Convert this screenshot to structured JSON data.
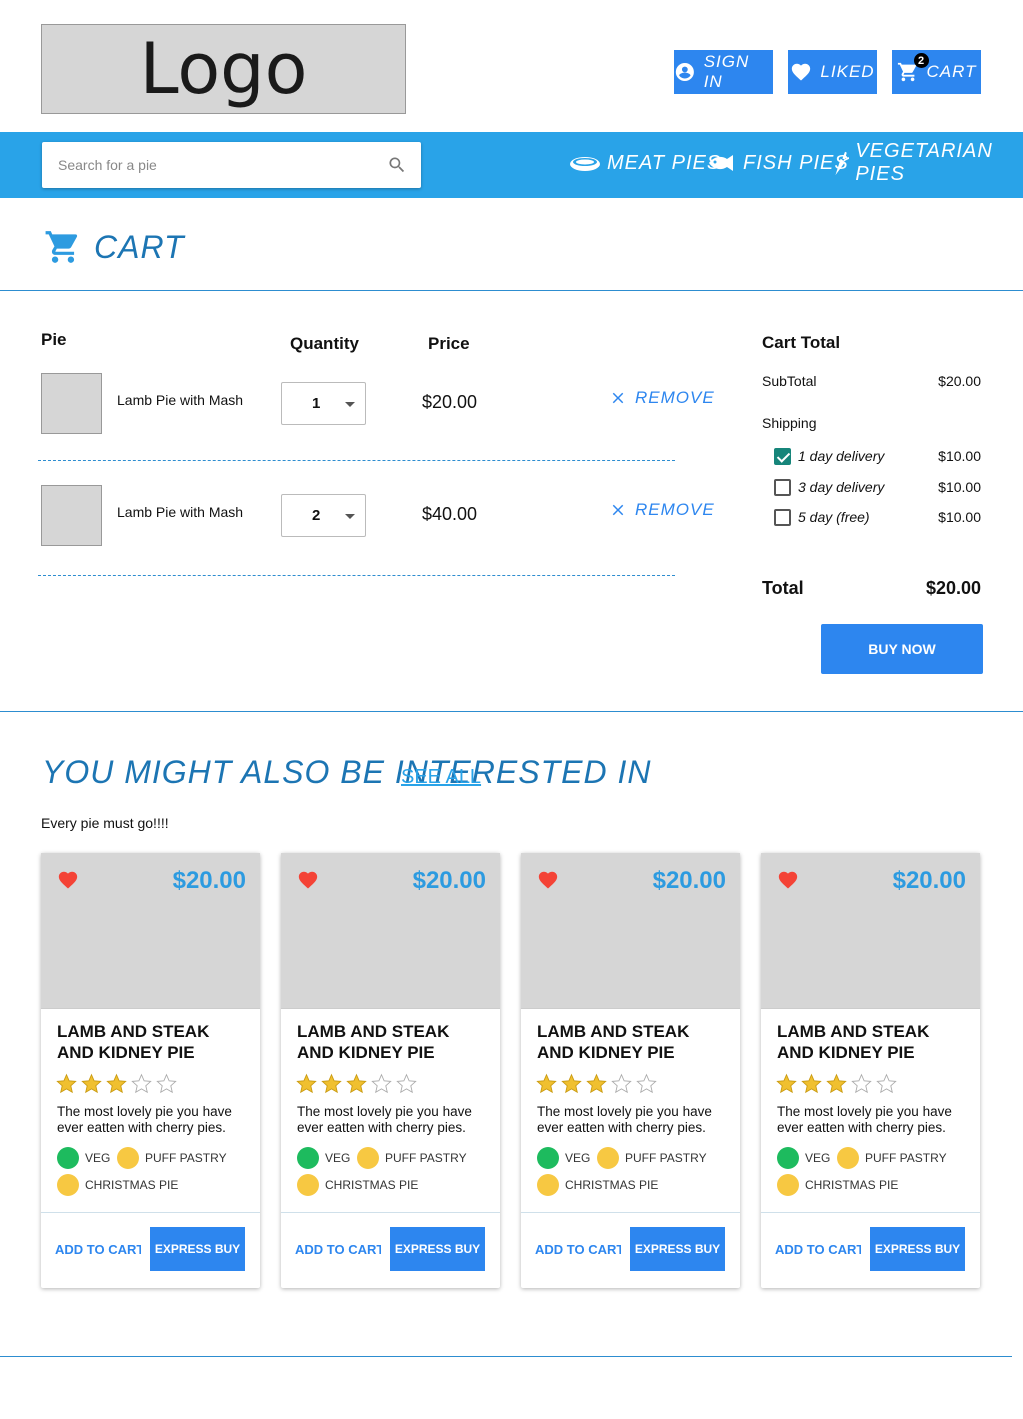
{
  "header": {
    "logo_text": "Logo",
    "sign_in_label": "SIGN IN",
    "liked_label": "LIKED",
    "cart_label": "CART",
    "cart_count": "2"
  },
  "nav": {
    "search_placeholder": "Search for a pie",
    "links": [
      "MEAT PIES",
      "FISH PIES",
      "VEGETARIAN PIES"
    ]
  },
  "cart": {
    "heading": "CART",
    "columns": {
      "pie": "Pie",
      "quantity": "Quantity",
      "price": "Price"
    },
    "remove_label": "REMOVE",
    "items": [
      {
        "name": "Lamb Pie with Mash",
        "quantity": "1",
        "price": "$20.00"
      },
      {
        "name": "Lamb Pie with Mash",
        "quantity": "2",
        "price": "$40.00"
      }
    ]
  },
  "cart_total": {
    "title": "Cart Total",
    "subtotal_label": "SubTotal",
    "subtotal_value": "$20.00",
    "shipping_label": "Shipping",
    "shipping_options": [
      {
        "label": "1 day delivery",
        "price": "$10.00",
        "checked": true
      },
      {
        "label": "3 day delivery",
        "price": "$10.00",
        "checked": false
      },
      {
        "label": "5 day (free)",
        "price": "$10.00",
        "checked": false
      }
    ],
    "total_label": "Total",
    "total_value": "$20.00",
    "buy_now_label": "BUY NOW"
  },
  "recommendations": {
    "title": "YOU MIGHT ALSO BE INTERESTED IN",
    "see_all_label": "SEE ALL",
    "subtitle": "Every pie must go!!!!",
    "products": [
      {
        "price": "$20.00",
        "title": "LAMB AND STEAK AND KIDNEY PIE",
        "rating": 3,
        "rating_max": 5,
        "description": "The most lovely pie you have ever eatten with cherry pies.",
        "tags": [
          "VEG",
          "PUFF PASTRY",
          "CHRISTMAS PIE"
        ],
        "add_to_cart_label": "ADD TO CART",
        "express_buy_label": "EXPRESS BUY"
      },
      {
        "price": "$20.00",
        "title": "LAMB AND STEAK AND KIDNEY PIE",
        "rating": 3,
        "rating_max": 5,
        "description": "The most lovely pie you have ever eatten with cherry pies.",
        "tags": [
          "VEG",
          "PUFF PASTRY",
          "CHRISTMAS PIE"
        ],
        "add_to_cart_label": "ADD TO CART",
        "express_buy_label": "EXPRESS BUY"
      },
      {
        "price": "$20.00",
        "title": "LAMB AND STEAK AND KIDNEY PIE",
        "rating": 3,
        "rating_max": 5,
        "description": "The most lovely pie you have ever eatten with cherry pies.",
        "tags": [
          "VEG",
          "PUFF PASTRY",
          "CHRISTMAS PIE"
        ],
        "add_to_cart_label": "ADD TO CART",
        "express_buy_label": "EXPRESS BUY"
      },
      {
        "price": "$20.00",
        "title": "LAMB AND STEAK AND KIDNEY PIE",
        "rating": 3,
        "rating_max": 5,
        "description": "The most lovely pie you have ever eatten with cherry pies.",
        "tags": [
          "VEG",
          "PUFF PASTRY",
          "CHRISTMAS PIE"
        ],
        "add_to_cart_label": "ADD TO CART",
        "express_buy_label": "EXPRESS BUY"
      }
    ]
  },
  "colors": {
    "primary_button": "#2d86ef",
    "nav_bar": "#29a3e8",
    "heading_blue": "#1c75b3",
    "heart_red": "#f44336",
    "star_gold": "#f0c030",
    "tag_veg_green": "#1dbb5e",
    "tag_yellow": "#f7c842",
    "checkbox_teal": "#16857a"
  },
  "icons": [
    "account-circle-icon",
    "heart-icon",
    "cart-icon",
    "search-icon",
    "meat-icon",
    "fish-icon",
    "carrot-icon",
    "close-icon",
    "star-icon"
  ]
}
